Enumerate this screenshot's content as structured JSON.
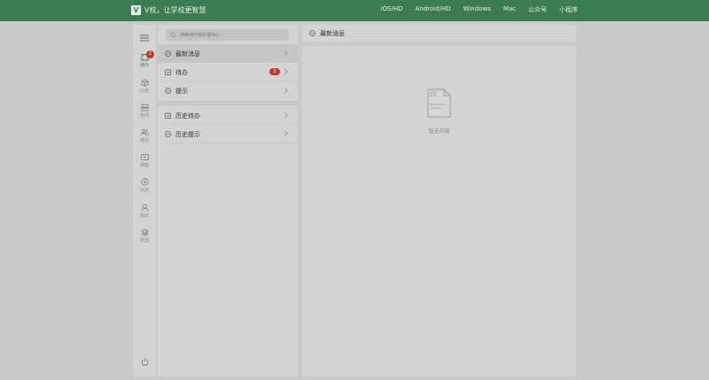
{
  "header": {
    "logo_letter": "V",
    "brand": "V校，让学校更智慧",
    "nav": [
      "iOS/HD",
      "Android/HD",
      "Windows",
      "Mac",
      "公众号",
      "小程序"
    ]
  },
  "rail": {
    "items": [
      {
        "label": "待办",
        "icon": "todo-icon",
        "badge": "2",
        "active": true
      },
      {
        "label": "应用",
        "icon": "cube-icon"
      },
      {
        "label": "空间",
        "icon": "layers-icon"
      },
      {
        "label": "通讯",
        "icon": "contacts-icon"
      },
      {
        "label": "课程",
        "icon": "video-icon"
      },
      {
        "label": "动态",
        "icon": "compass-icon"
      },
      {
        "label": "我的",
        "icon": "user-icon"
      },
      {
        "label": "管理",
        "icon": "stack-icon"
      }
    ]
  },
  "search": {
    "placeholder": "搜索待办或处理中心"
  },
  "list": {
    "items": [
      {
        "label": "最新消息",
        "icon": "message-icon"
      },
      {
        "label": "待办",
        "icon": "todo-icon",
        "badge": "2"
      },
      {
        "label": "提示",
        "icon": "info-icon"
      },
      {
        "label": "历史待办",
        "icon": "todo-icon"
      },
      {
        "label": "历史提示",
        "icon": "info-icon"
      }
    ]
  },
  "chat": {
    "title": "最新消息",
    "empty_text": "暂无内容"
  },
  "colors": {
    "brand_green": "#3c7c52",
    "badge_red": "#c0392b",
    "overlay_gray": "#c9c9c9"
  }
}
